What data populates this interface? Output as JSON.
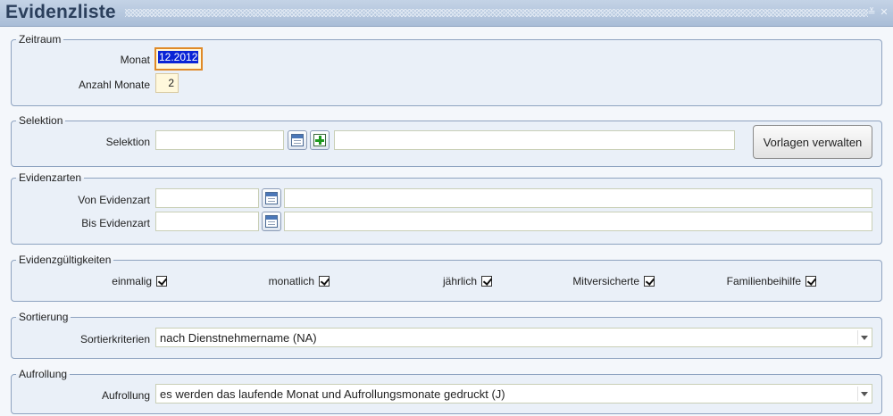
{
  "window": {
    "title": "Evidenzliste",
    "minimize_glyph": "≚",
    "close_glyph": "✕"
  },
  "zeitraum": {
    "legend": "Zeitraum",
    "monat_label": "Monat",
    "monat_value": "12.2012",
    "anzahl_label": "Anzahl Monate",
    "anzahl_value": "2"
  },
  "selektion": {
    "legend": "Selektion",
    "label": "Selektion",
    "value": "",
    "description": "",
    "button_label": "Vorlagen verwalten"
  },
  "evidenzarten": {
    "legend": "Evidenzarten",
    "von_label": "Von Evidenzart",
    "von_value": "",
    "von_description": "",
    "bis_label": "Bis Evidenzart",
    "bis_value": "",
    "bis_description": ""
  },
  "gueltigkeiten": {
    "legend": "Evidenzgültigkeiten",
    "items": [
      {
        "label": "einmalig",
        "checked": true
      },
      {
        "label": "monatlich",
        "checked": true
      },
      {
        "label": "jährlich",
        "checked": true
      },
      {
        "label": "Mitversicherte",
        "checked": true
      },
      {
        "label": "Familienbeihilfe",
        "checked": true
      }
    ]
  },
  "sortierung": {
    "legend": "Sortierung",
    "label": "Sortierkriterien",
    "selected": "nach Dienstnehmername (NA)"
  },
  "aufrollung": {
    "legend": "Aufrollung",
    "label": "Aufrollung",
    "selected": "es werden das laufende Monat und Aufrollungsmonate gedruckt (J)"
  },
  "icons": [
    "calendar-lookup-icon",
    "add-icon",
    "dropdown-arrow-icon",
    "checkmark-icon"
  ]
}
